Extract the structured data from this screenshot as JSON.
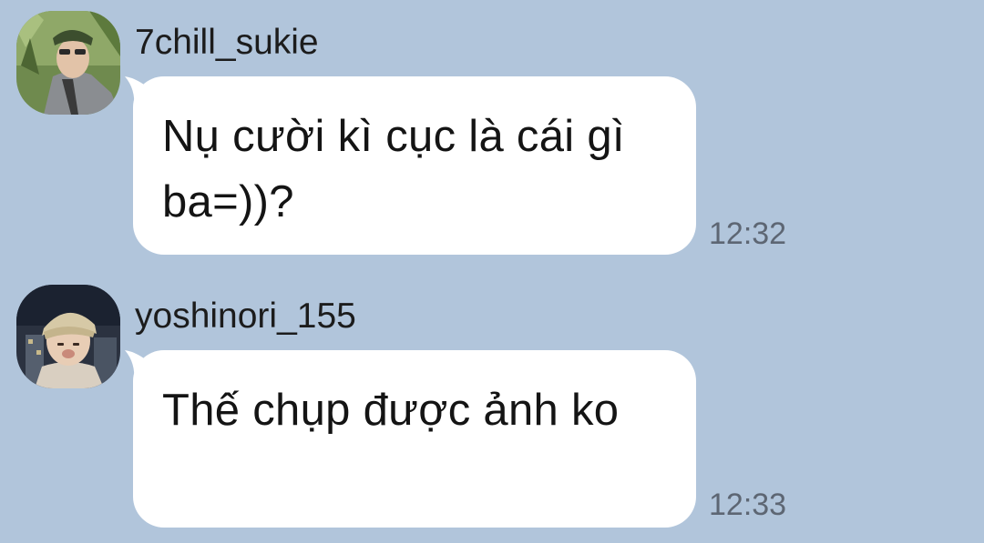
{
  "colors": {
    "background": "#b1c5db",
    "bubble": "#ffffff",
    "sender_text": "#1c1c1c",
    "message_text": "#141414",
    "timestamp_text": "#5d6673"
  },
  "messages": [
    {
      "sender": "7chill_sukie",
      "avatar_icon": "user-avatar-photo",
      "text": "Nụ cười kì cục là cái gì ba=))?",
      "time": "12:32"
    },
    {
      "sender": "yoshinori_155",
      "avatar_icon": "user-avatar-photo",
      "text": "Thế chụp được ảnh ko",
      "time": "12:33"
    }
  ]
}
